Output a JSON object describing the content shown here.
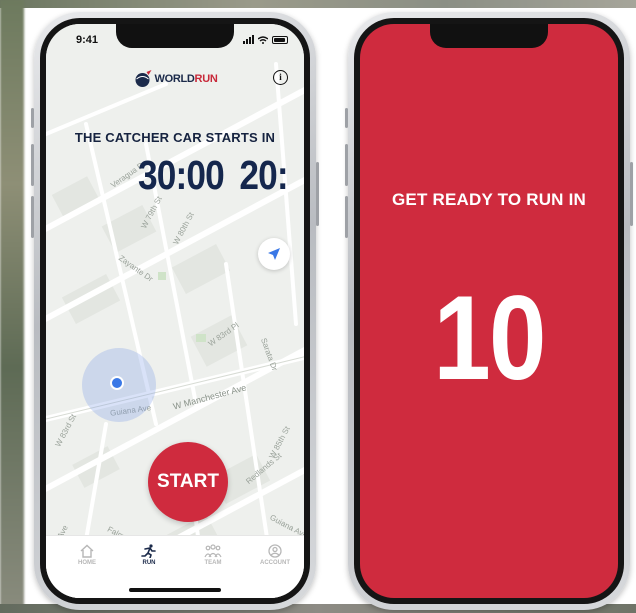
{
  "left_phone": {
    "status_time": "9:41",
    "logo": {
      "prefix": "WORLD",
      "suffix": "RUN"
    },
    "catcher_title": "THE CATCHER CAR STARTS IN",
    "countdown_primary": "30:00",
    "countdown_secondary": "20:",
    "start_label": "START",
    "map_labels": {
      "verague": "Veragua Dr",
      "w79th": "W 79th St",
      "w80th": "W 80th St",
      "zayante": "Zayante Dr",
      "w83rd_pl": "W 83rd Pl",
      "sarata": "Sarata Dr",
      "guiana": "Guiana Ave",
      "w83rd_st": "W 83rd St",
      "manchester": "W Manchester Ave",
      "w85th": "W 85th St",
      "redlands": "Redlands St",
      "falmouth": "Falmouth",
      "tef": "tef Ave",
      "guiana2": "Guiana Ave"
    },
    "tabs": [
      {
        "label": "HOME",
        "icon": "home-icon"
      },
      {
        "label": "RUN",
        "icon": "runner-icon"
      },
      {
        "label": "TEAM",
        "icon": "team-icon"
      },
      {
        "label": "ACCOUNT",
        "icon": "account-icon"
      }
    ],
    "active_tab": "RUN"
  },
  "right_phone": {
    "title": "GET READY TO RUN IN",
    "count": "10"
  },
  "colors": {
    "brand_red": "#cf2b3e",
    "navy": "#15274d",
    "location_blue": "#3a78e6"
  }
}
